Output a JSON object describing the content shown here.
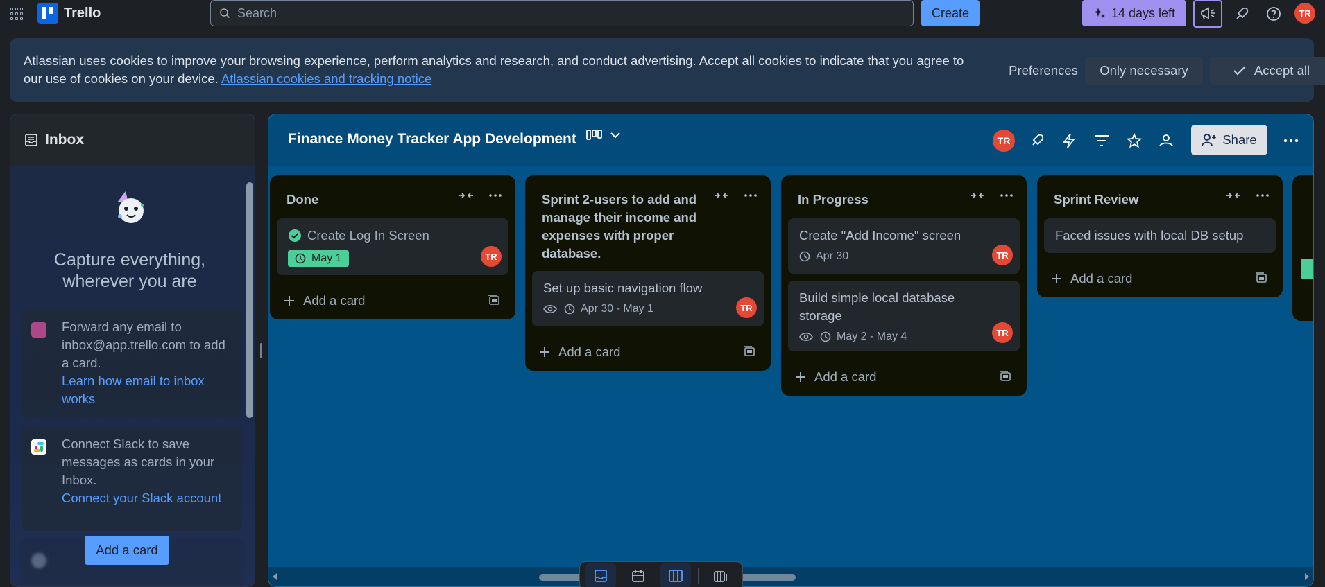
{
  "topnav": {
    "app_name": "Trello",
    "search_placeholder": "Search",
    "create_label": "Create",
    "trial_label": "14 days left",
    "user_initials": "TR",
    "brand_color": "#0c66e4",
    "icons": [
      "apps-grid-icon",
      "sparkle-icon",
      "megaphone-icon",
      "rocket-icon",
      "help-icon"
    ]
  },
  "cookie_banner": {
    "text": "Atlassian uses cookies to improve your browsing experience, perform analytics and research, and conduct advertising. Accept all cookies to indicate that you agree to our use of cookies on your device.",
    "link_text": "Atlassian cookies and tracking notice",
    "preferences_label": "Preferences",
    "only_necessary_label": "Only necessary",
    "accept_all_label": "Accept all"
  },
  "inbox": {
    "title": "Inbox",
    "headline": "Capture everything, wherever you are",
    "tips": [
      {
        "text": "Forward any email to inbox@app.trello.com to add a card.",
        "link": "Learn how email to inbox works"
      },
      {
        "text": "Connect Slack to save messages as cards in your Inbox.",
        "link": "Connect your Slack account"
      }
    ],
    "add_card_label": "Add a card"
  },
  "board": {
    "title": "Finance Money Tracker App Development",
    "member_initials": "TR",
    "share_label": "Share",
    "background_color": "#025488",
    "lists": [
      {
        "title": "Done",
        "cards": [
          {
            "title": "Create Log In Screen",
            "date": "May 1",
            "complete": true,
            "member": "TR"
          }
        ],
        "add_label": "Add a card"
      },
      {
        "title": "Sprint 2-users to add and manage their income and expenses with proper database.",
        "cards": [
          {
            "title": "Set up basic navigation flow",
            "date": "Apr 30 - May 1",
            "watching": true,
            "member": "TR"
          }
        ],
        "add_label": "Add a card"
      },
      {
        "title": "In Progress",
        "cards": [
          {
            "title": "Create \"Add Income\" screen",
            "date": "Apr 30",
            "member": "TR"
          },
          {
            "title": "Build simple local database storage",
            "date": "May 2 - May 4",
            "watching": true,
            "member": "TR"
          }
        ],
        "add_label": "Add a card"
      },
      {
        "title": "Sprint Review",
        "cards": [
          {
            "title": "Faced issues with local DB setup"
          }
        ],
        "add_label": "Add a card"
      }
    ]
  }
}
